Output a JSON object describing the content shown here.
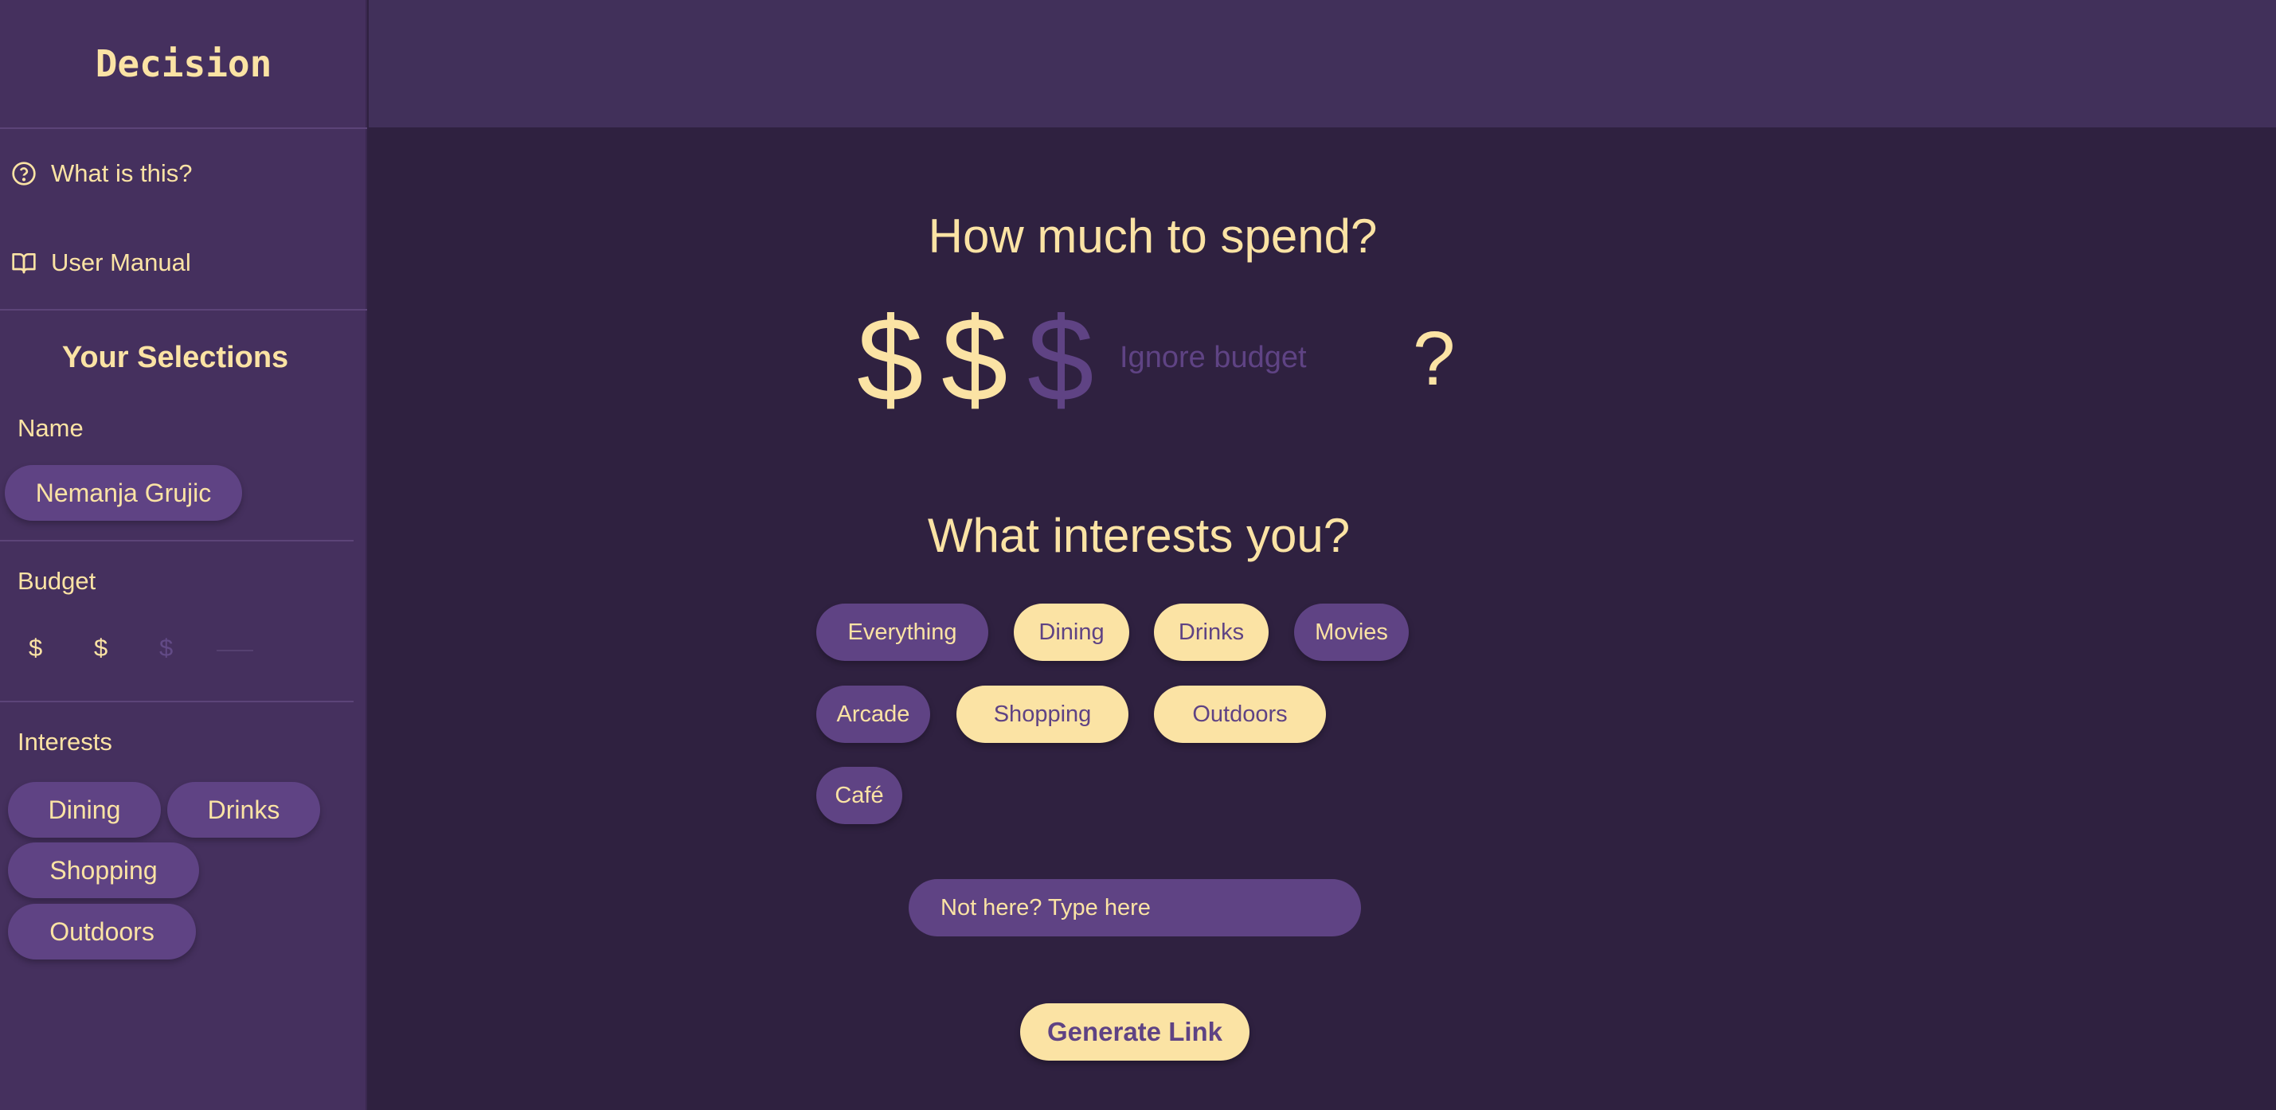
{
  "app": {
    "title": "Decision"
  },
  "nav": {
    "about": {
      "label": "What is this?",
      "icon": "help-circle-icon"
    },
    "manual": {
      "label": "User Manual",
      "icon": "book-icon"
    }
  },
  "selections": {
    "title": "Your Selections",
    "name_label": "Name",
    "name_value": "Nemanja Grujic",
    "budget_label": "Budget",
    "budget_symbols": [
      "$",
      "$",
      "$"
    ],
    "budget_level": 2,
    "interests_label": "Interests",
    "interests": [
      "Dining",
      "Drinks",
      "Shopping",
      "Outdoors"
    ]
  },
  "main": {
    "spend_title": "How much to spend?",
    "dollars": [
      "$",
      "$",
      "$"
    ],
    "budget_level": 2,
    "ignore_budget": "Ignore budget",
    "help_symbol": "?",
    "interests_title": "What interests you?",
    "interest_options": [
      {
        "label": "Everything",
        "selected": false
      },
      {
        "label": "Dining",
        "selected": true
      },
      {
        "label": "Drinks",
        "selected": true
      },
      {
        "label": "Movies",
        "selected": false
      },
      {
        "label": "Arcade",
        "selected": false
      },
      {
        "label": "Shopping",
        "selected": true
      },
      {
        "label": "Outdoors",
        "selected": true
      },
      {
        "label": "Café",
        "selected": false
      }
    ],
    "custom_placeholder": "Not here? Type here",
    "generate_label": "Generate Link"
  },
  "colors": {
    "accent": "#fbe3a4",
    "pill": "#5f4384",
    "sidebar": "#45305e",
    "background": "#2f2140"
  }
}
